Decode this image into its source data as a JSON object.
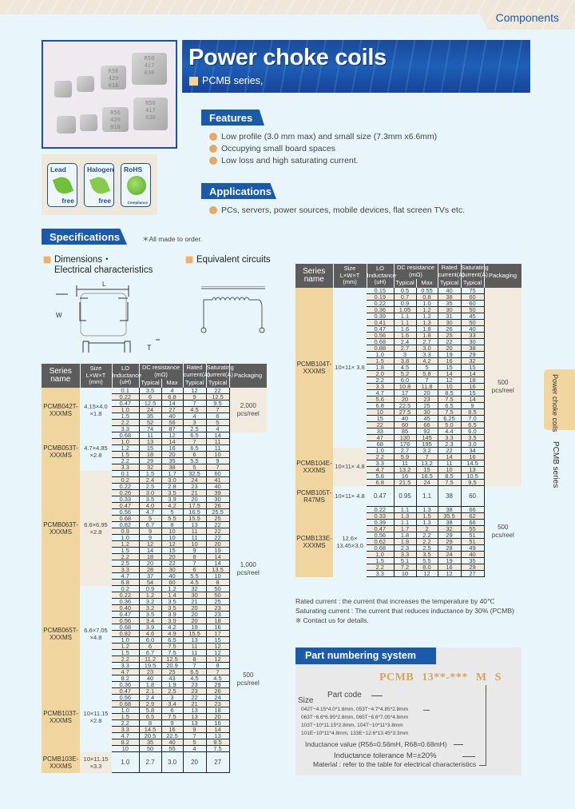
{
  "header": {
    "section": "Components"
  },
  "banner": {
    "title": "Power choke coils",
    "subtitle": "PCMB series,"
  },
  "product_photo": {
    "chips": [
      {
        "marking": "R56\n429\n018"
      },
      {
        "marking": "R50\n4i7\n030"
      }
    ]
  },
  "eco_badges": [
    {
      "top": "Lead",
      "bottom": "free"
    },
    {
      "top": "Halogen",
      "bottom": "free"
    },
    {
      "top": "RoHS",
      "bottom": "Compliance"
    }
  ],
  "features": {
    "heading": "Features",
    "items": [
      "Low profile (3.0 mm max) and small size (7.3mm x6.6mm)",
      "Occupying small board spaces",
      "Low loss and high saturating current."
    ]
  },
  "applications": {
    "heading": "Applications",
    "items": [
      "PCs, servers, power sources, mobile devices, flat screen TVs etc."
    ]
  },
  "specifications": {
    "heading": "Specifications",
    "note": "＊All made to order.",
    "dimensions_heading_1": "Dimensions・",
    "dimensions_heading_2": "Electrical characteristics",
    "circuit_heading": "Equivalent circuits",
    "dim_labels": {
      "L": "L",
      "W": "W",
      "T": "T"
    }
  },
  "table_headers": {
    "series": "Series name",
    "size": "Size L×W×T (mm)",
    "size_1": "Size",
    "size_2": "L×W×T",
    "size_3": "(mm)",
    "lo_1": "LO",
    "lo_2": "Inductance",
    "lo_3": "(uH)",
    "dcr_1": "DC resistance",
    "dcr_2": "(mΩ)",
    "typical": "Typical",
    "max": "Max",
    "rated_1": "Rated",
    "rated_2": "current(A)",
    "sat_1": "Saturating",
    "sat_2": "current(A)",
    "packaging": "Packaging",
    "series_1": "Series",
    "series_2": "name"
  },
  "left_table": [
    {
      "series": "PCMB042T-XXXMS",
      "size": "4.15×4.0 ×1.8",
      "packaging": "2,000 pcs/reel",
      "rows": [
        [
          "0.1",
          "3.5",
          "4",
          "12",
          "22"
        ],
        [
          "0.22",
          "6",
          "6.8",
          "9",
          "12.5"
        ],
        [
          "0.47",
          "12.5",
          "14",
          "7",
          "9.5"
        ],
        [
          "1.0",
          "24",
          "27",
          "4.5",
          "7"
        ],
        [
          "1.5",
          "35",
          "40",
          "4",
          "6"
        ],
        [
          "2.2",
          "52",
          "56",
          "3",
          "5"
        ],
        [
          "3.3",
          "74",
          "87",
          "2.5",
          "4"
        ]
      ]
    },
    {
      "series": "PCMB053T-XXXMS",
      "size": "4.7×4.85 ×2.8",
      "packaging": "",
      "rows": [
        [
          "0.68",
          "11",
          "12",
          "6.5",
          "14"
        ],
        [
          "1.0",
          "13",
          "14",
          "7",
          "11"
        ],
        [
          "1.2",
          "15",
          "16",
          "6.5",
          "11"
        ],
        [
          "1.5",
          "18",
          "20",
          "6",
          "10"
        ],
        [
          "2.2",
          "29",
          "35",
          "5.5",
          "9"
        ],
        [
          "3.3",
          "32",
          "38",
          "5",
          "7"
        ]
      ]
    },
    {
      "series": "PCMB063T-XXXMS",
      "size": "6.6×6.95 ×2.8",
      "packaging": "1,000 pcs/reel",
      "rows": [
        [
          "0.1",
          "1.5",
          "1.7",
          "32.5",
          "60"
        ],
        [
          "0.2",
          "2.4",
          "3.0",
          "24",
          "41"
        ],
        [
          "0.22",
          "2.5",
          "2.8",
          "23",
          "40"
        ],
        [
          "0.26",
          "3.0",
          "3.5",
          "21",
          "39"
        ],
        [
          "0.33",
          "3.5",
          "3.9",
          "20",
          "30"
        ],
        [
          "0.47",
          "4.0",
          "4.2",
          "17.5",
          "26"
        ],
        [
          "0.56",
          "4.7",
          "5",
          "16.5",
          "25.5"
        ],
        [
          "0.68",
          "5",
          "5.5",
          "15.5",
          "25"
        ],
        [
          "0.82",
          "6.7",
          "8",
          "13",
          "22"
        ],
        [
          "0.9",
          "9",
          "10",
          "11",
          "22"
        ],
        [
          "1.0",
          "9",
          "10",
          "11",
          "22"
        ],
        [
          "1.2",
          "12",
          "12",
          "10",
          "20"
        ],
        [
          "1.5",
          "14",
          "15",
          "9",
          "19"
        ],
        [
          "2.2",
          "18",
          "20",
          "8",
          "14"
        ],
        [
          "2.5",
          "20",
          "22",
          "7",
          "14"
        ],
        [
          "3.3",
          "28",
          "30",
          "6",
          "13.5"
        ],
        [
          "4.7",
          "37",
          "40",
          "5.5",
          "10"
        ],
        [
          "6.8",
          "54",
          "60",
          "4.5",
          "8"
        ]
      ]
    },
    {
      "series": "PCMB065T-XXXMS",
      "size": "6.6×7.05 ×4.8",
      "packaging": "",
      "rows": [
        [
          "0.2",
          "0.9",
          "1.2",
          "32",
          "50"
        ],
        [
          "0.22",
          "1.2",
          "1.4",
          "30",
          "50"
        ],
        [
          "0.36",
          "3.2",
          "3.5",
          "21",
          "25"
        ],
        [
          "0.40",
          "3.2",
          "3.5",
          "20",
          "23"
        ],
        [
          "0.47",
          "3.5",
          "3.9",
          "20",
          "23"
        ],
        [
          "0.56",
          "3.4",
          "3.9",
          "20",
          "18"
        ],
        [
          "0.68",
          "3.9",
          "4.2",
          "19",
          "16"
        ],
        [
          "0.82",
          "4.6",
          "4.9",
          "15.5",
          "17"
        ],
        [
          "1.0",
          "6.0",
          "6.5",
          "13",
          "15"
        ],
        [
          "1.2",
          "6",
          "7.5",
          "11",
          "12"
        ],
        [
          "1.5",
          "6.7",
          "7.5",
          "11",
          "12"
        ],
        [
          "2.2",
          "11.2",
          "12.5",
          "8",
          "12"
        ],
        [
          "3.3",
          "19.5",
          "20.9",
          "7",
          "8"
        ],
        [
          "4.7",
          "23",
          "25",
          "6.5",
          "7"
        ],
        [
          "8.2",
          "40",
          "43",
          "4.5",
          "4.5"
        ]
      ]
    },
    {
      "series": "PCMB103T-XXXMS",
      "size": "10×11.15 ×2.8",
      "packaging": "500 pcs/reel",
      "rows": [
        [
          "0.36",
          "1.8",
          "1.9",
          "23",
          "29"
        ],
        [
          "0.47",
          "2.1",
          "2.5",
          "23",
          "26"
        ],
        [
          "0.56",
          "2.4",
          "3",
          "22",
          "24"
        ],
        [
          "0.68",
          "2.9",
          "3.4",
          "21",
          "23"
        ],
        [
          "1.0",
          "5.8",
          "6",
          "13",
          "18"
        ],
        [
          "1.5",
          "6.5",
          "7.5",
          "13",
          "20"
        ],
        [
          "2.2",
          "8",
          "9",
          "13",
          "16"
        ],
        [
          "3.3",
          "14.5",
          "16",
          "9",
          "14"
        ],
        [
          "4.7",
          "20.5",
          "22.5",
          "7",
          "13"
        ],
        [
          "8.2",
          "35",
          "40",
          "5",
          "9.5"
        ],
        [
          "10",
          "50",
          "55",
          "4",
          "7.5"
        ]
      ]
    },
    {
      "series": "PCMB103E-XXXMS",
      "size": "10×11.15 ×3.3",
      "packaging": "",
      "rows": [
        [
          "1.0",
          "2.7",
          "3.0",
          "20",
          "27"
        ]
      ]
    }
  ],
  "right_table": [
    {
      "series": "PCMB104T-XXXMS",
      "size": "10×11× 3.8",
      "packaging": "500 pcs/reel",
      "rows": [
        [
          "0.15",
          "0.5",
          "0.55",
          "40",
          "75"
        ],
        [
          "0.19",
          "0.7",
          "0.8",
          "38",
          "60"
        ],
        [
          "0.22",
          "0.9",
          "1.0",
          "35",
          "60"
        ],
        [
          "0.36",
          "1.05",
          "1.2",
          "30",
          "50"
        ],
        [
          "0.39",
          "1.1",
          "1.2",
          "31",
          "45"
        ],
        [
          "0.41",
          "1.1",
          "1.3",
          "30",
          "50"
        ],
        [
          "0.47",
          "1.6",
          "1.8",
          "26",
          "40"
        ],
        [
          "0.56",
          "1.6",
          "1.8",
          "25",
          "33"
        ],
        [
          "0.68",
          "2.4",
          "2.7",
          "22",
          "30"
        ],
        [
          "0.88",
          "2.7",
          "3.0",
          "20",
          "38"
        ],
        [
          "1.0",
          "3",
          "3.3",
          "19",
          "29"
        ],
        [
          "1.5",
          "3.8",
          "4.2",
          "16",
          "32"
        ],
        [
          "1.8",
          "4.5",
          "5",
          "15",
          "15"
        ],
        [
          "2.0",
          "5.2",
          "5.8",
          "14",
          "14"
        ],
        [
          "2.2",
          "6.0",
          "7",
          "12",
          "18"
        ],
        [
          "3.3",
          "10.8",
          "11.8",
          "10",
          "16"
        ],
        [
          "4.7",
          "17",
          "20",
          "8.5",
          "15"
        ],
        [
          "5.6",
          "20",
          "23",
          "7.5",
          "14"
        ],
        [
          "6.8",
          "22.5",
          "25",
          "6.5",
          "9"
        ],
        [
          "10",
          "27.5",
          "30",
          "7.5",
          "8.5"
        ],
        [
          "15",
          "40",
          "45",
          "6.25",
          "7.0"
        ],
        [
          "22",
          "60",
          "66",
          "5.0",
          "6.5"
        ],
        [
          "33",
          "85",
          "92",
          "4.4",
          "6.0"
        ],
        [
          "47",
          "130",
          "145",
          "3.3",
          "3.5"
        ],
        [
          "68",
          "176",
          "195",
          "2.3",
          "3.0"
        ]
      ]
    },
    {
      "series": "PCMB104E-XXXMS",
      "size": "10×11× 4.8",
      "packaging": "",
      "rows": [
        [
          "1.0",
          "2.7",
          "3.2",
          "22",
          "34"
        ],
        [
          "2.2",
          "5.9",
          "7",
          "14",
          "16"
        ],
        [
          "3.3",
          "11",
          "13.2",
          "11",
          "14.5"
        ],
        [
          "4.7",
          "13.2",
          "15",
          "10",
          "13"
        ],
        [
          "5.6",
          "16",
          "18.5",
          "8.5",
          "10.5"
        ],
        [
          "6.8",
          "21.5",
          "24",
          "7.5",
          "9.5"
        ]
      ]
    },
    {
      "series": "PCMB105T-R47MS",
      "size": "10×11× 4.8",
      "packaging": "500 pcs/reel",
      "rows": [
        [
          "0.47",
          "0.95",
          "1.1",
          "38",
          "60"
        ]
      ]
    },
    {
      "series": "PCMB133E-XXXMS",
      "size": "12.6× 13.45×3.0",
      "packaging": "",
      "rows": [
        [
          "0.22",
          "1.1",
          "1.3",
          "38",
          "66"
        ],
        [
          "0.33",
          "1.3",
          "1.5",
          "35.5",
          "62"
        ],
        [
          "0.39",
          "1.1",
          "1.3",
          "38",
          "66"
        ],
        [
          "0.47",
          "1.7",
          "2",
          "32",
          "55"
        ],
        [
          "0.56",
          "1.8",
          "2.2",
          "29",
          "51"
        ],
        [
          "0.62",
          "1.8",
          "2.2",
          "29",
          "51"
        ],
        [
          "0.68",
          "2.3",
          "2.5",
          "28",
          "49"
        ],
        [
          "1.0",
          "3.3",
          "3.5",
          "24",
          "40"
        ],
        [
          "1.5",
          "5.1",
          "5.5",
          "19",
          "35"
        ],
        [
          "2.2",
          "7.2",
          "8.0",
          "16",
          "29"
        ],
        [
          "3.3",
          "10",
          "12",
          "12",
          "27"
        ]
      ]
    }
  ],
  "notes": [
    "Rated current : the current that increases the temperature by 40℃",
    "Saturating current : The current that reduces inductance by 30% (PCMB)",
    "※ Contact us for details."
  ],
  "part_numbering": {
    "heading": "Part numbering system",
    "code": "PCMB 13**-*** M S",
    "size_label": "Size",
    "part_code_label": "Part code",
    "size_lines": [
      "042T−4.15*4.0*1.8mm, 053T−4.7*4.85*2.8mm",
      "063T−6.6*6.95*2.8mm, 065T−6.6*7.05*4.8mm",
      "103T−10*11.15*2.8mm, 104T−10*11*3.8mm",
      "101E−10*11*4.8mm, 133E−12.6*13.45*3.3mm"
    ],
    "inductance_value": "Inductance value (R56=0.56mH, R68=0.68mH)",
    "tolerance": "Inductance tolerance  M=±20%",
    "material": "Material : refer to the table for electrical characteristics"
  },
  "side_tab": {
    "category": "Power choke coils",
    "series": "PCMB series"
  }
}
